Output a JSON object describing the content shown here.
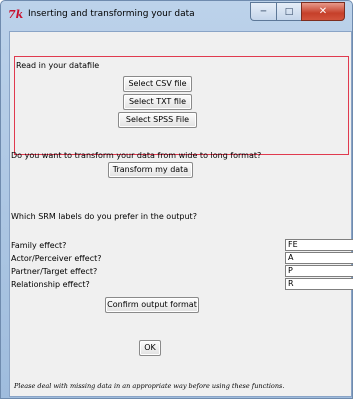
{
  "window": {
    "title": "Inserting and transforming your data",
    "app_icon": "tk-feather-icon",
    "controls": {
      "minimize": "minimize-icon",
      "maximize": "maximize-icon",
      "close": "close-icon"
    }
  },
  "read_section": {
    "label": "Read in your datafile",
    "csv_button": "Select CSV file",
    "txt_button": "Select TXT file",
    "spss_button": "Select SPSS File"
  },
  "transform_section": {
    "question": "Do you want to transform your data from wide to long format?",
    "button": "Transform my data"
  },
  "srm_section": {
    "question": "Which SRM labels do you prefer in the output?",
    "fields": [
      {
        "label": "Family effect?",
        "value": "FE"
      },
      {
        "label": "Actor/Perceiver effect?",
        "value": "A"
      },
      {
        "label": "Partner/Target effect?",
        "value": "P"
      },
      {
        "label": "Relationship effect?",
        "value": "R"
      }
    ],
    "confirm_button": "Confirm output format"
  },
  "ok_button": "OK",
  "footer_note": "Please deal with missing data in an appropriate way before using these functions.",
  "colors": {
    "frame_border": "#e03a4e",
    "title_icon": "#c8102e",
    "close_button": "#c6402a"
  }
}
